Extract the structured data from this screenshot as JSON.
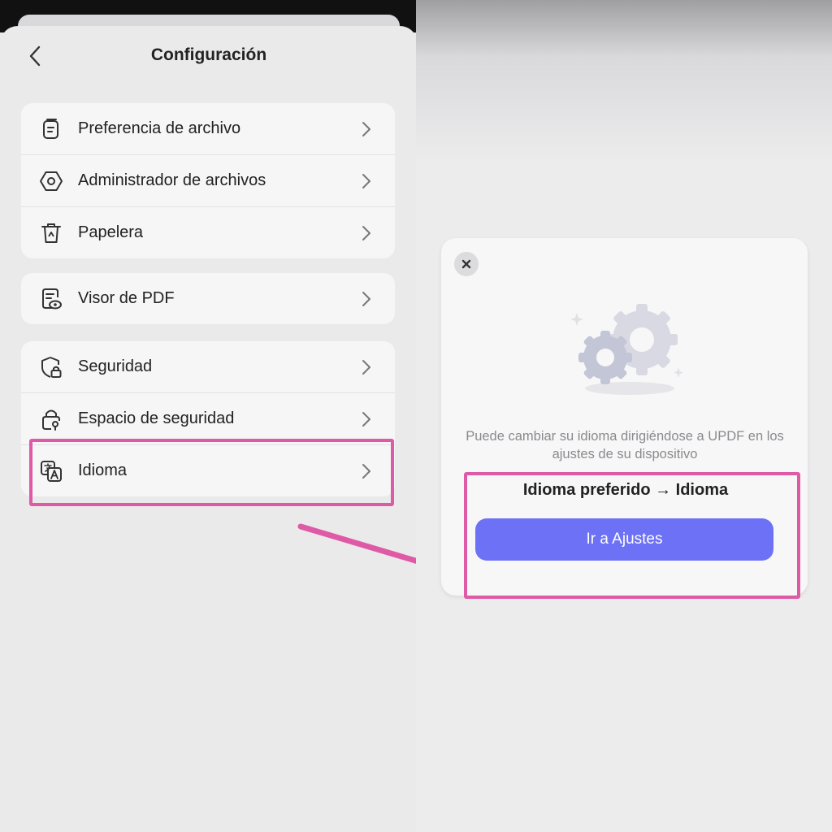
{
  "header": {
    "title": "Configuración"
  },
  "settings": {
    "groups": [
      {
        "items": [
          {
            "label": "Preferencia de archivo",
            "icon": "document-icon"
          },
          {
            "label": "Administrador de archivos",
            "icon": "hexagon-icon"
          },
          {
            "label": "Papelera",
            "icon": "trash-icon"
          }
        ]
      },
      {
        "items": [
          {
            "label": "Visor de PDF",
            "icon": "pdf-viewer-icon"
          }
        ]
      },
      {
        "items": [
          {
            "label": "Seguridad",
            "icon": "shield-lock-icon"
          },
          {
            "label": "Espacio de seguridad",
            "icon": "lock-key-icon"
          },
          {
            "label": "Idioma",
            "icon": "translate-icon"
          }
        ]
      }
    ]
  },
  "dialog": {
    "message": "Puede cambiar su idioma dirigiéndose a UPDF en los ajustes de su dispositivo",
    "path": "Idioma preferido → Idioma",
    "button_label": "Ir a Ajustes"
  },
  "colors": {
    "accent": "#6d71f5",
    "highlight": "#df5aa6",
    "background": "#ebeaeb",
    "card": "#f6f6f7"
  }
}
